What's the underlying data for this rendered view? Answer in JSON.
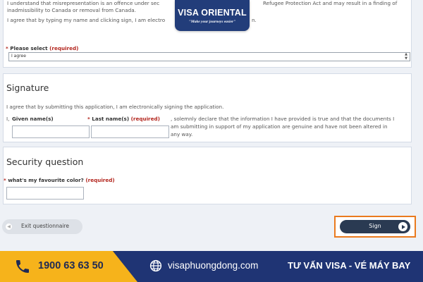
{
  "declaration": {
    "line1_start": "I understand that misrepresentation is an offence under sec",
    "line1_end": "Refugee Protection Act and may result in a finding of",
    "line2": "inadmissibility to Canada or removal from Canada.",
    "line3_start": "I agree that by typing my name and clicking sign, I am electro",
    "line3_end": "n.",
    "please_select_label": "Please select",
    "required": "(required)",
    "select_value": "I agree"
  },
  "signature": {
    "title": "Signature",
    "intro": "I agree that by submitting this application, I am electronically signing the application.",
    "prefix": "I,",
    "given_name_label": "Given name(s)",
    "last_name_label": "Last name(s)",
    "required": "(required)",
    "statement_line1": ", solemnly declare that the information I have provided is true and that the documents I",
    "statement_line2": "am submitting in support of my application are genuine and have not been altered in",
    "statement_line3": "any way."
  },
  "security": {
    "title": "Security question",
    "question_label": "what's my favourite color?",
    "required": "(required)"
  },
  "buttons": {
    "exit": "Exit questionnaire",
    "sign": "Sign"
  },
  "logo": {
    "brand": "VISA ORIENTAL",
    "slogan": "\"Make your journeys easier\""
  },
  "footer": {
    "phone": "1900 63 63 50",
    "website": "visaphuongdong.com",
    "service": "TƯ VẤN VISA - VÉ MÁY BAY"
  },
  "colors": {
    "footer_blue": "#1f3474",
    "footer_yellow": "#f6b31b",
    "sign_button": "#2a3a52",
    "highlight_orange": "#ea7a1e",
    "required_red": "#b3261e"
  }
}
